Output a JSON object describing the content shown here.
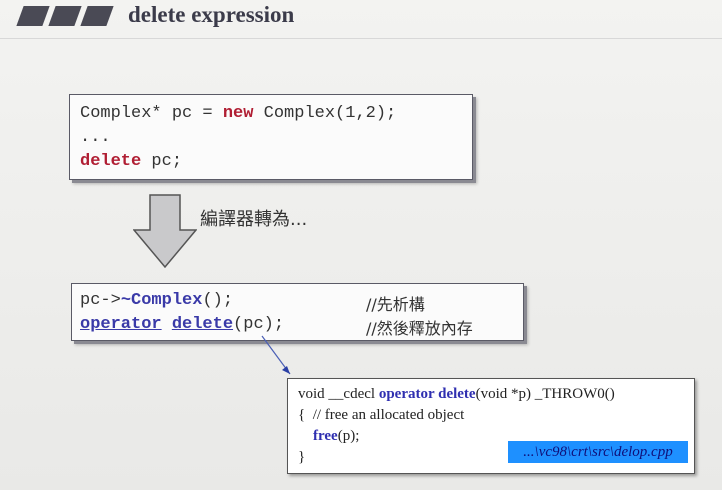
{
  "slide": {
    "title": "delete expression",
    "box1": {
      "line1_pre": "Complex* pc = ",
      "line1_kw": "new",
      "line1_post": " Complex(1,2);",
      "line2": "...",
      "line3_kw": "delete",
      "line3_post": " pc;"
    },
    "arrow_label": "編譯器轉為...",
    "box2": {
      "line1_pre": "pc->",
      "line1_kw": "~Complex",
      "line1_post": "();",
      "line1_comment": "//先析構",
      "line2_kw1": "operator",
      "line2_sp": " ",
      "line2_kw2": "delete",
      "line2_post": "(pc);",
      "line2_comment": "//然後釋放內存"
    },
    "box3": {
      "l1_pre": "void __cdecl ",
      "l1_kw": "operator delete",
      "l1_post": "(void *p) _THROW0()",
      "l2": "{  // free an allocated object",
      "l3_indent": "    ",
      "l3_kw": "free",
      "l3_post": "(p);",
      "l4": "}"
    },
    "file_path": "...\\vc98\\crt\\src\\delop.cpp"
  },
  "colors": {
    "keyword_red": "#b01e33",
    "keyword_blue": "#3a3aa8",
    "badge_blue": "#1e90ff"
  }
}
